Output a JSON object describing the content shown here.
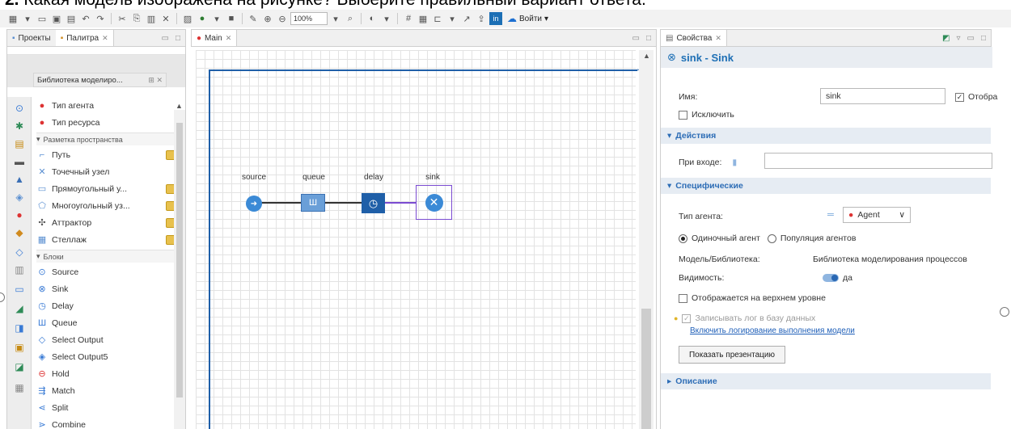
{
  "question": {
    "number": "2.",
    "text": "Какая модель изображена на рисунке? Выберите правильный вариант ответа."
  },
  "toolbar": {
    "zoom": "100%",
    "login_label": "Войти"
  },
  "left_panel": {
    "tab_projects": "Проекты",
    "tab_palette": "Палитра",
    "library_tab": "Библиотека моделиро...",
    "items": [
      {
        "label": "Тип агента",
        "icon": "agent-type-icon"
      },
      {
        "label": "Тип ресурса",
        "icon": "resource-type-icon"
      }
    ],
    "section_space": "Разметка пространства",
    "space_items": [
      {
        "label": "Путь",
        "icon": "path-icon"
      },
      {
        "label": "Точечный узел",
        "icon": "point-node-icon"
      },
      {
        "label": "Прямоугольный у...",
        "icon": "rect-node-icon"
      },
      {
        "label": "Многоугольный уз...",
        "icon": "polygon-node-icon"
      },
      {
        "label": "Аттрактор",
        "icon": "attractor-icon"
      },
      {
        "label": "Стеллаж",
        "icon": "rack-icon"
      }
    ],
    "section_blocks": "Блоки",
    "blocks": [
      {
        "label": "Source",
        "icon": "source-icon"
      },
      {
        "label": "Sink",
        "icon": "sink-icon"
      },
      {
        "label": "Delay",
        "icon": "delay-icon"
      },
      {
        "label": "Queue",
        "icon": "queue-icon"
      },
      {
        "label": "Select Output",
        "icon": "select-output-icon"
      },
      {
        "label": "Select Output5",
        "icon": "select-output5-icon"
      },
      {
        "label": "Hold",
        "icon": "hold-icon"
      },
      {
        "label": "Match",
        "icon": "match-icon"
      },
      {
        "label": "Split",
        "icon": "split-icon"
      },
      {
        "label": "Combine",
        "icon": "combine-icon"
      }
    ]
  },
  "main": {
    "tab": "Main",
    "blocks": [
      {
        "label": "source"
      },
      {
        "label": "queue"
      },
      {
        "label": "delay"
      },
      {
        "label": "sink"
      }
    ]
  },
  "properties": {
    "tab": "Свойства",
    "title": "sink - Sink",
    "name_label": "Имя:",
    "name_value": "sink",
    "show_label": "Отобра",
    "exclude_label": "Исключить",
    "section_actions": "Действия",
    "on_enter_label": "При входе:",
    "section_specific": "Специфические",
    "agent_type_label": "Тип агента:",
    "agent_type_value": "Agent",
    "single_agent": "Одиночный агент",
    "agent_population": "Популяция агентов",
    "model_library_label": "Модель/Библиотека:",
    "model_library_value": "Библиотека моделирования процессов",
    "visibility_label": "Видимость:",
    "visibility_value": "да",
    "top_level_label": "Отображается на верхнем уровне",
    "log_label": "Записывать лог в базу данных",
    "enable_log_link": "Включить логирование выполнения модели",
    "show_presentation": "Показать презентацию",
    "section_description": "Описание"
  },
  "colors": {
    "accent": "#1d6fb5",
    "block_blue": "#3b8ad6",
    "queue_blue": "#6a9fd8",
    "delay_blue": "#1f5fa8",
    "sink_border": "#7b4bd1"
  }
}
